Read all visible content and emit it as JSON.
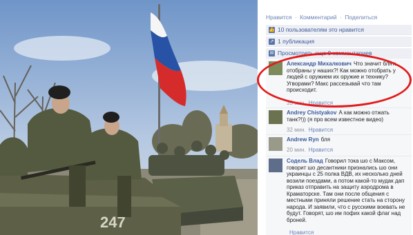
{
  "actions": {
    "like": "Нравится",
    "comment": "Комментарий",
    "share": "Поделиться",
    "separator": "·"
  },
  "likes_row": {
    "text": "10 пользователям это нравится",
    "icon": "thumbs-up-icon"
  },
  "shares_row": {
    "text": "1 публикация",
    "icon": "share-icon"
  },
  "more_comments": {
    "text": "Просмотреть еще 9 комментариев",
    "icon": "comment-icon"
  },
  "comments": [
    {
      "author": "Александр Михалкович",
      "text": "Что значит блять отобраны у наших?! Как можно отобрать у людей с оружием их оружие и технику? Угворами? Макс рассезывай что там происходит.",
      "time": "35 мин.",
      "like": "Нравится"
    },
    {
      "author": "Andrey Chistyakov",
      "text": "А как можно отжать танк?!)) (я про всем известное видео)",
      "time": "32 мин.",
      "like": "Нравится"
    },
    {
      "author": "Andrew Ryn",
      "text": "бля",
      "time": "20 мин.",
      "like": "Нравится"
    },
    {
      "author": "Содель Влад",
      "text": "Говорил тока шо с Максом, говорит шо десантники признались шо они украинцы с 25 полка ВДВ, их несколько дней возили поездами, а потом какой-то мудак дап приказ отправить на защиту аэродрома в Краматорске. Там они после общения с местными приняли решение стать на сторону народа. И заявили, что с русскими воевать не будут. Говорят, шо им пофих какой флаг над броней.",
      "time": "",
      "like": "Нравится"
    }
  ],
  "photo": {
    "vehicle_number": "247"
  },
  "colors": {
    "link": "#3b5998",
    "meta_link": "#6d84b4",
    "highlight": "#e21b1b",
    "row_bg": "#edeff4"
  }
}
